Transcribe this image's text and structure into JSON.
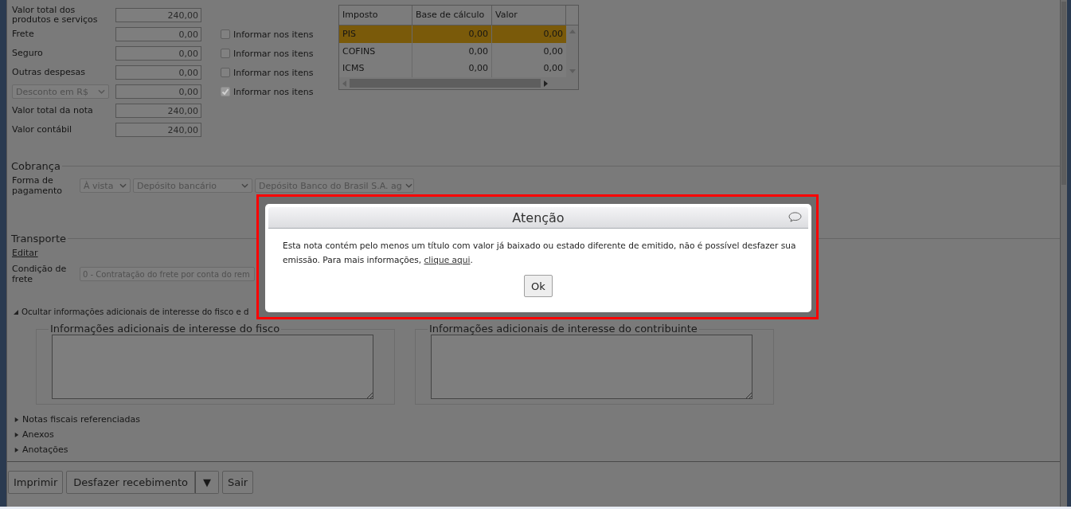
{
  "totals": {
    "rows": [
      {
        "kind": "label",
        "label": "Valor total dos produtos e serviços",
        "value": "240,00"
      },
      {
        "kind": "label",
        "label": "Frete",
        "value": "0,00",
        "option": {
          "label": "Informar nos itens",
          "checked": false,
          "disabled": false
        }
      },
      {
        "kind": "label",
        "label": "Seguro",
        "value": "0,00",
        "option": {
          "label": "Informar nos itens",
          "checked": false,
          "disabled": false
        }
      },
      {
        "kind": "label",
        "label": "Outras despesas",
        "value": "0,00",
        "option": {
          "label": "Informar nos itens",
          "checked": false,
          "disabled": false
        }
      },
      {
        "kind": "select",
        "label": "Desconto em R$",
        "value": "0,00",
        "option": {
          "label": "Informar nos itens",
          "checked": true,
          "disabled": true
        }
      },
      {
        "kind": "label",
        "label": "Valor total da nota",
        "value": "240,00"
      },
      {
        "kind": "label",
        "label": "Valor contábil",
        "value": "240,00"
      }
    ]
  },
  "tax_table": {
    "columns": [
      "Imposto",
      "Base de cálculo",
      "Valor"
    ],
    "rows": [
      {
        "cells": [
          "PIS",
          "0,00",
          "0,00"
        ],
        "selected": true
      },
      {
        "cells": [
          "COFINS",
          "0,00",
          "0,00"
        ],
        "selected": false
      },
      {
        "cells": [
          "ICMS",
          "0,00",
          "0,00"
        ],
        "selected": false
      }
    ]
  },
  "billing": {
    "legend": "Cobrança",
    "label": "Forma de pagamento",
    "selects": [
      "À vista",
      "Depósito bancário",
      "Depósito Banco do Brasil S.A. ag"
    ]
  },
  "transport": {
    "legend": "Transporte",
    "link": "Editar",
    "label": "Condição de frete",
    "value": "0 - Contratação do frete por conta do rem"
  },
  "info_toggle": {
    "label": "Ocultar informações adicionais de interesse do fisco e d",
    "expanded": true
  },
  "additional_info": [
    {
      "legend": "Informações adicionais de interesse do fisco"
    },
    {
      "legend": "Informações adicionais de interesse do contribuinte"
    }
  ],
  "sections": [
    {
      "label": "Notas fiscais referenciadas",
      "expanded": false
    },
    {
      "label": "Anexos",
      "expanded": false
    },
    {
      "label": "Anotações",
      "expanded": false
    }
  ],
  "buttons": [
    {
      "kind": "button",
      "label": "Imprimir"
    },
    {
      "kind": "split",
      "label": "Desfazer recebimento",
      "caret": "▼"
    },
    {
      "kind": "button",
      "label": "Sair"
    }
  ],
  "dialog": {
    "title": "Atenção",
    "message": "Esta nota contém pelo menos um título com valor já baixado ou estado diferente de emitido, não é possível desfazer sua emissão. Para mais informações, ",
    "link": "clique aqui",
    "message_end": ".",
    "button": "Ok"
  }
}
